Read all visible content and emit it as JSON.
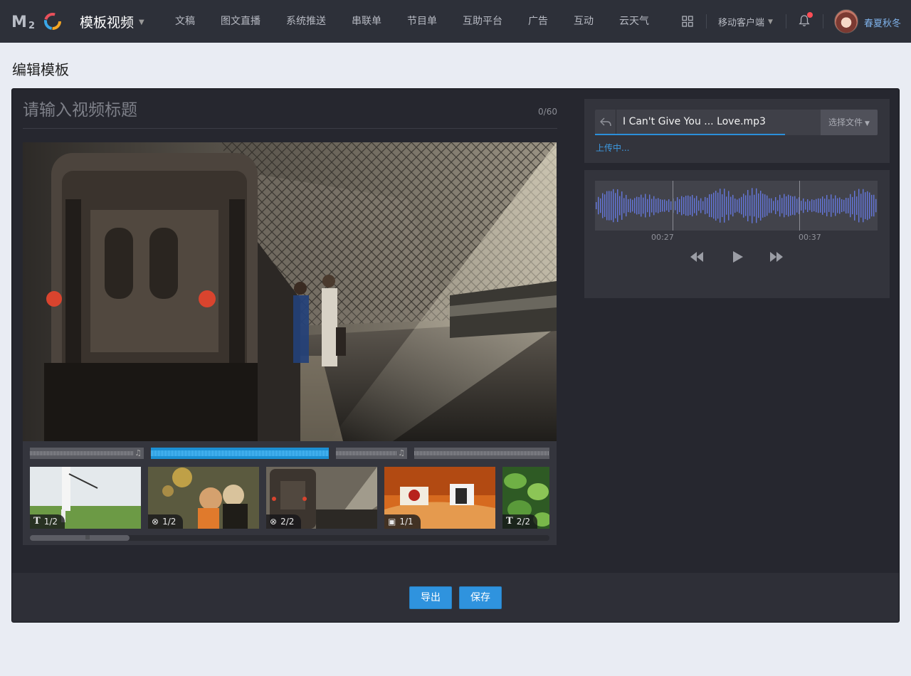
{
  "header": {
    "logo_text": "M2C",
    "app_title": "模板视频",
    "nav": [
      "文稿",
      "图文直播",
      "系统推送",
      "串联单",
      "节目单",
      "互助平台",
      "广告",
      "互动",
      "云天气"
    ],
    "client_link": "移动客户端",
    "username": "春夏秋冬",
    "icons": {
      "apps": "grid-icon",
      "notifications": "bell-icon"
    },
    "notification_dot_color": "#ff4d56"
  },
  "page": {
    "heading": "编辑模板"
  },
  "editor": {
    "title_placeholder": "请输入视频标题",
    "title_value": "",
    "char_count": "0/60",
    "timeline": {
      "clips": [
        {
          "badge_icon": "text-icon",
          "badge": "1/2"
        },
        {
          "badge_icon": "video-off-icon",
          "badge": "1/2"
        },
        {
          "badge_icon": "video-off-icon",
          "badge": "2/2"
        },
        {
          "badge_icon": "image-icon",
          "badge": "1/1"
        },
        {
          "badge_icon": "text-icon",
          "badge": "2/2"
        }
      ]
    }
  },
  "audio": {
    "file_name": "I Can't Give You ... Love.mp3",
    "choose_file_label": "选择文件",
    "upload_status": "上传中...",
    "time_start": "00:27",
    "time_end": "00:37",
    "controls": [
      "rewind-icon",
      "play-icon",
      "fast-forward-icon"
    ]
  },
  "actions": {
    "export_label": "导出",
    "save_label": "保存"
  },
  "colors": {
    "accent": "#2f93de",
    "nav_bg": "#2d3039",
    "panel_bg": "#26272f",
    "waveform_active": "#1c8fd3"
  }
}
